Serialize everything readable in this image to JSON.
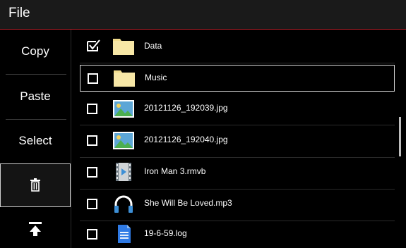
{
  "header": {
    "title": "File"
  },
  "sidebar": {
    "copy": "Copy",
    "paste": "Paste",
    "select": "Select",
    "delete_icon": "trash-icon",
    "top_icon": "scroll-to-top-icon"
  },
  "files": [
    {
      "name": "Data",
      "type": "folder",
      "checked": true
    },
    {
      "name": "Music",
      "type": "folder",
      "checked": false,
      "selected": true
    },
    {
      "name": "20121126_192039.jpg",
      "type": "image",
      "checked": false
    },
    {
      "name": "20121126_192040.jpg",
      "type": "image",
      "checked": false
    },
    {
      "name": "Iron Man 3.rmvb",
      "type": "video",
      "checked": false
    },
    {
      "name": "She Will Be Loved.mp3",
      "type": "audio",
      "checked": false
    },
    {
      "name": "19-6-59.log",
      "type": "document",
      "checked": false
    }
  ],
  "colors": {
    "accent_line": "#b0202a",
    "folder": "#f7e7a6",
    "image_bg": "#5ca6d6",
    "document": "#2f7ae5"
  }
}
